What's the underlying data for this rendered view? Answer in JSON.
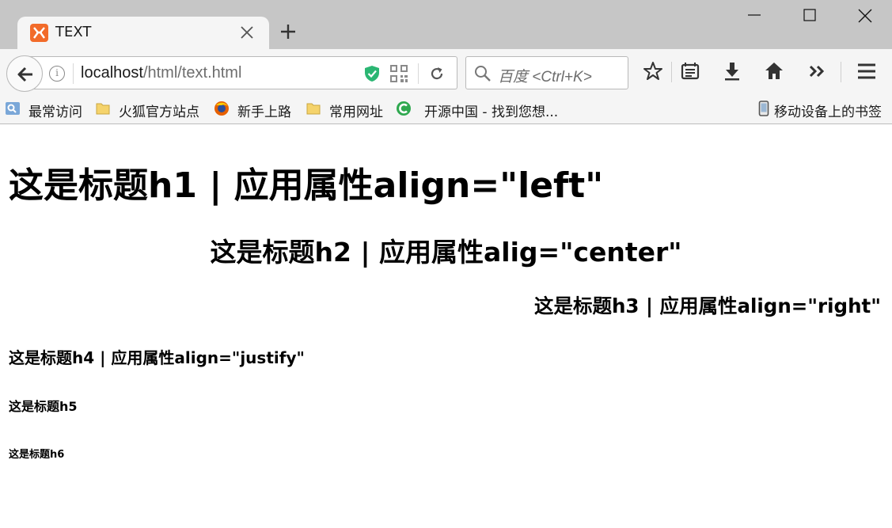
{
  "browser": {
    "tab": {
      "title": "TEXT"
    },
    "url": {
      "host": "localhost",
      "path": "/html/text.html"
    },
    "search": {
      "placeholder": "百度 <Ctrl+K>"
    },
    "bookmarks": [
      {
        "label": "最常访问",
        "icon": "frequent-icon"
      },
      {
        "label": "火狐官方站点",
        "icon": "folder-icon"
      },
      {
        "label": "新手上路",
        "icon": "firefox-icon"
      },
      {
        "label": "常用网址",
        "icon": "folder-icon"
      },
      {
        "label": "开源中国 - 找到您想...",
        "icon": "oschina-icon"
      }
    ],
    "mobile_bookmarks": {
      "label": "移动设备上的书签",
      "icon": "mobile-icon"
    },
    "colors": {
      "tabstrip": "#c6c6c6",
      "toolbar": "#f5f5f5",
      "favicon": "#f26b2a"
    }
  },
  "page": {
    "h1": "这是标题h1 | 应用属性align=\"left\"",
    "h2": "这是标题h2 | 应用属性alig=\"center\"",
    "h3": "这是标题h3 | 应用属性align=\"right\"",
    "h4": "这是标题h4 | 应用属性align=\"justify\"",
    "h5": "这是标题h5",
    "h6": "这是标题h6"
  }
}
